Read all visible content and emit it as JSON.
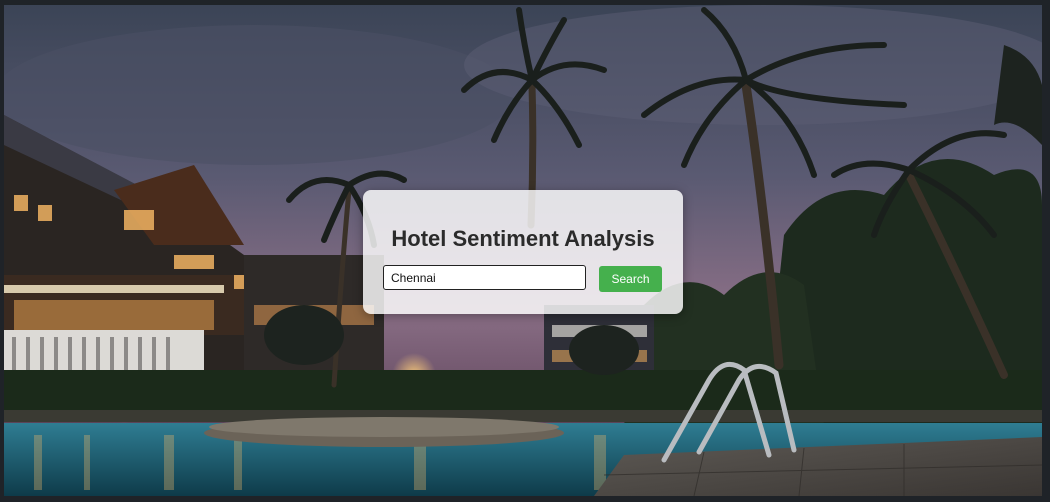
{
  "app": {
    "title": "Hotel Sentiment Analysis"
  },
  "search": {
    "value": "Chennai",
    "button_label": "Search"
  },
  "colors": {
    "button": "#45b04d",
    "card": "#ffffffd1",
    "title": "#2b2b2b"
  }
}
